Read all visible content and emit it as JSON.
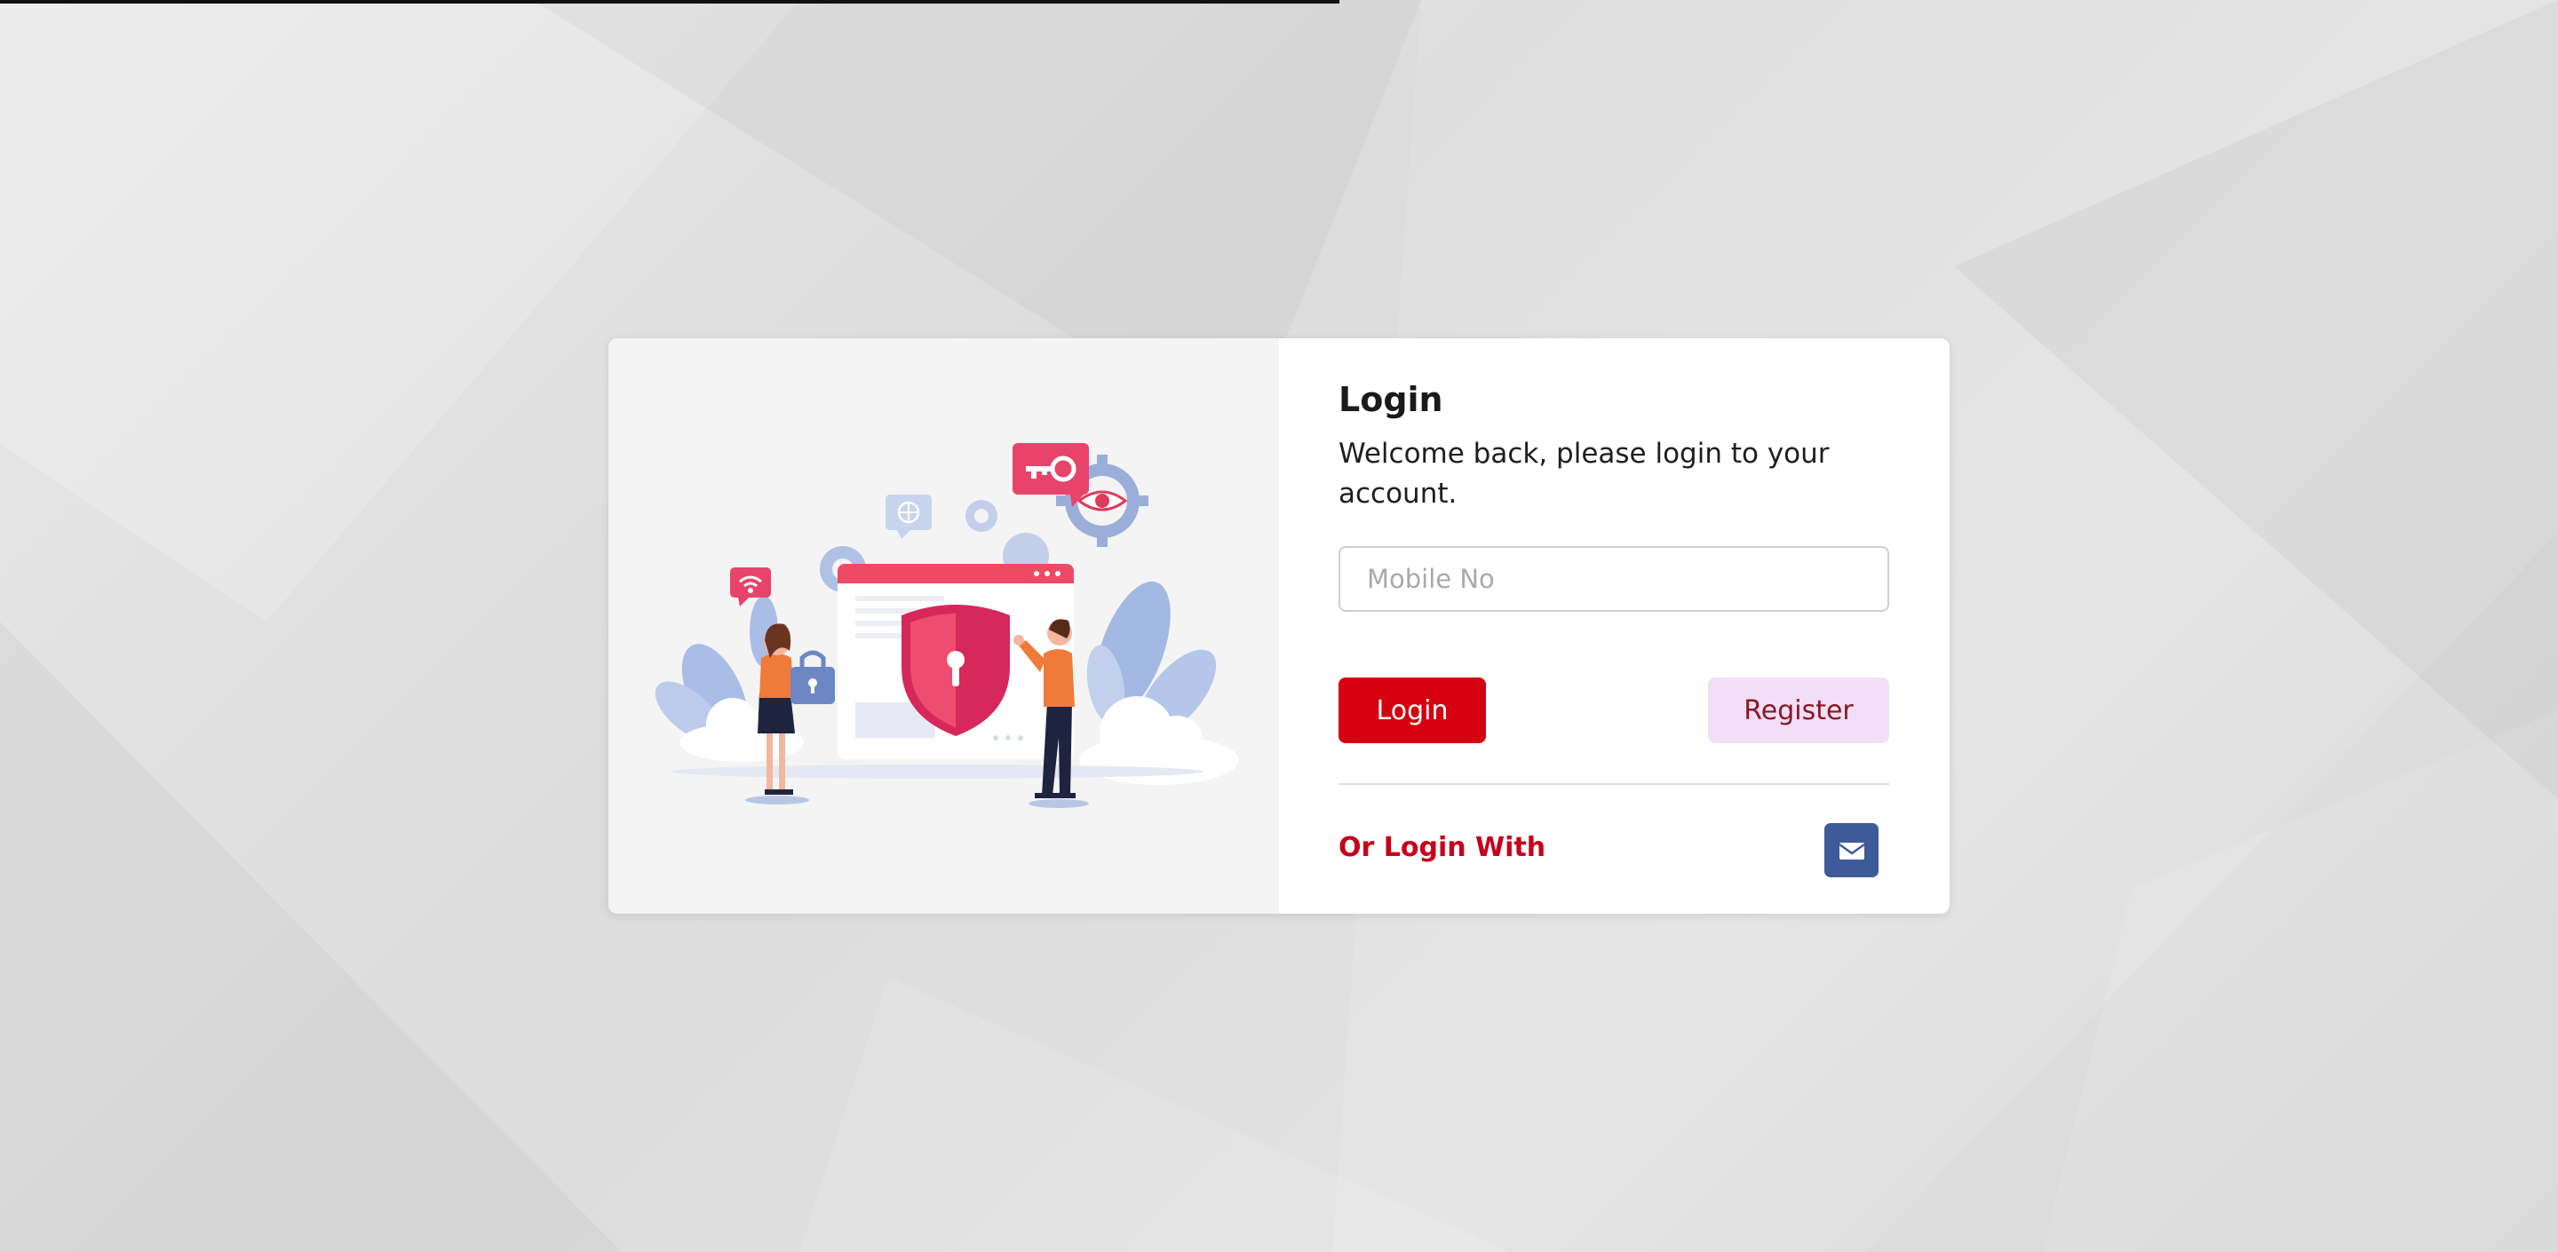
{
  "login": {
    "title": "Login",
    "subtitle": "Welcome back, please login to your account.",
    "mobile_placeholder": "Mobile No",
    "mobile_value": "",
    "login_button": "Login",
    "register_button": "Register",
    "alt_login_label": "Or Login With",
    "alt_login_icon": "envelope-icon"
  },
  "colors": {
    "login_button_bg": "#d50010",
    "register_button_bg": "#f2dff7",
    "register_text": "#8b1622",
    "alt_label": "#c8001a",
    "mail_button_bg": "#3d5a99",
    "illustration_panel_bg": "#f4f4f4"
  },
  "illustration": {
    "icons": [
      "security-shield-icon",
      "key-icon",
      "eye-icon",
      "gear-icon",
      "globe-icon",
      "wifi-icon",
      "padlock-icon"
    ]
  }
}
